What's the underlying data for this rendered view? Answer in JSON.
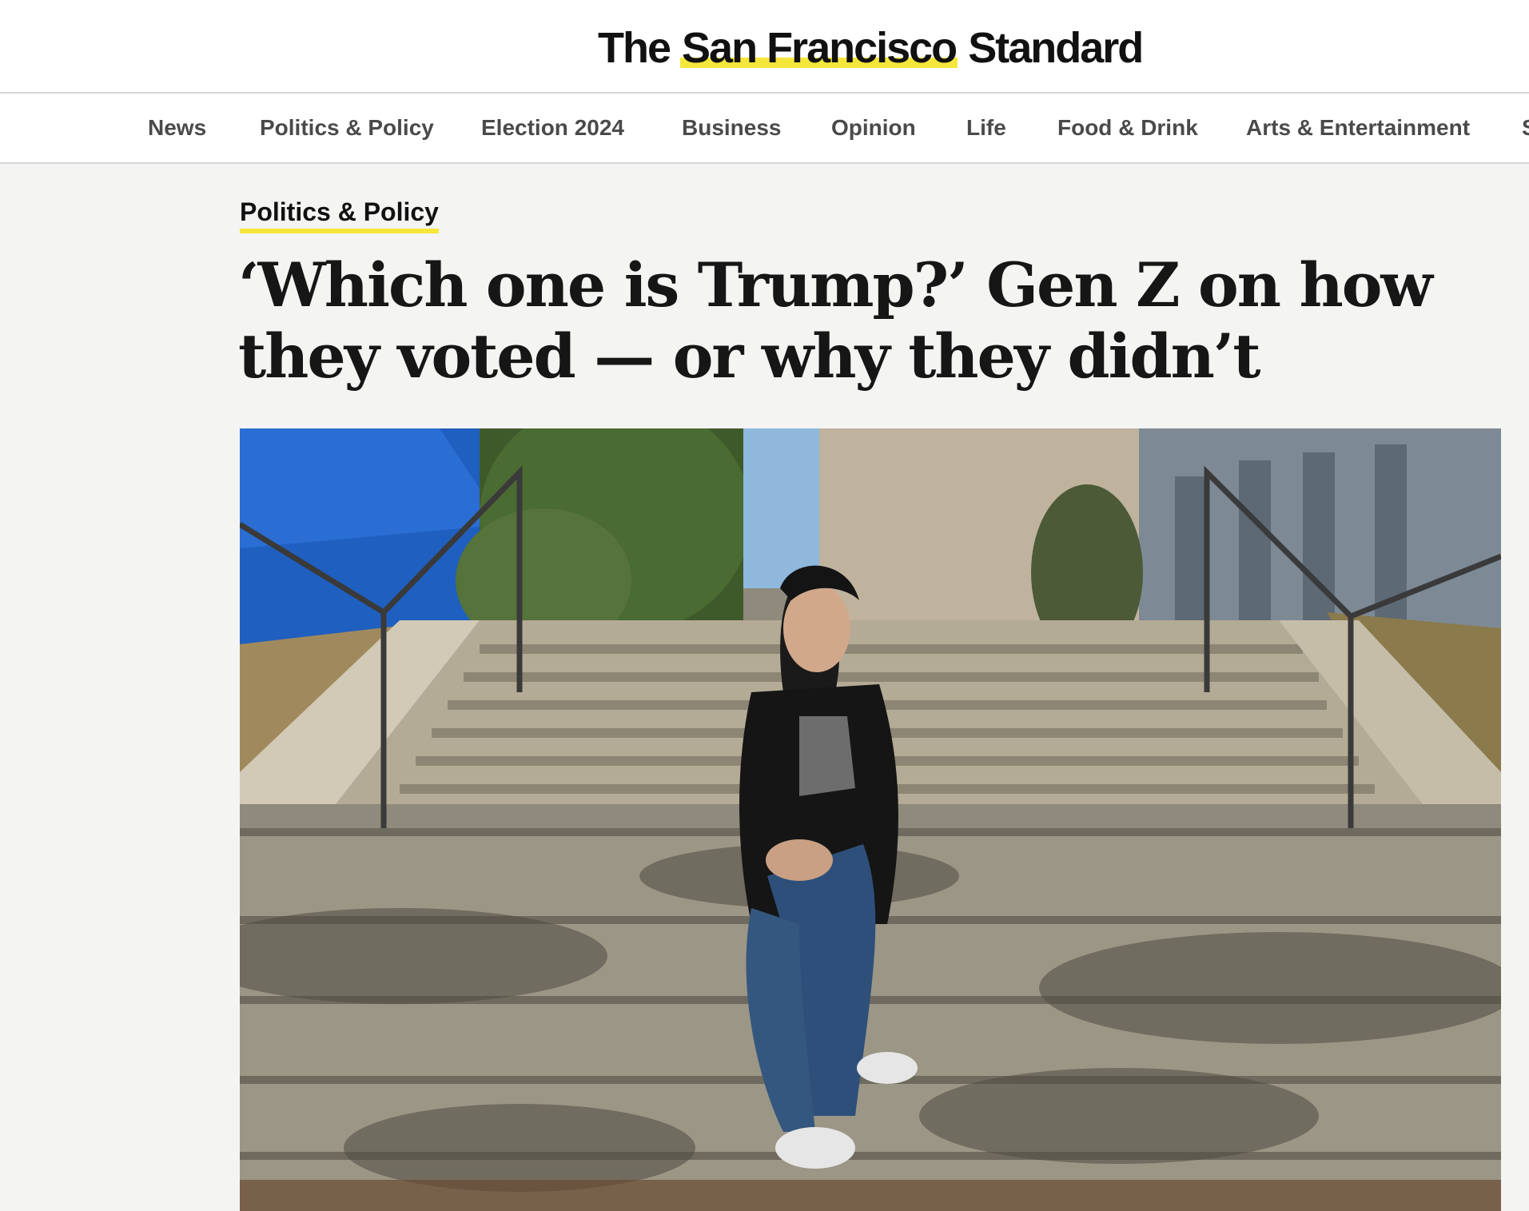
{
  "site": {
    "logo_prefix": "The",
    "logo_highlight": "San Francisco",
    "logo_suffix": "Standard",
    "accent_color": "#f5e63c"
  },
  "nav": {
    "items": [
      {
        "label": "News"
      },
      {
        "label": "Politics & Policy"
      },
      {
        "label": "Election 2024"
      },
      {
        "label": "Business"
      },
      {
        "label": "Opinion"
      },
      {
        "label": "Life"
      },
      {
        "label": "Food & Drink"
      },
      {
        "label": "Arts & Entertainment"
      },
      {
        "label": "S"
      }
    ]
  },
  "article": {
    "category": "Politics & Policy",
    "headline": "‘Which one is Trump?’ Gen Z on how they voted — or why they didn’t",
    "hero_image_icon": "photo-icon"
  }
}
